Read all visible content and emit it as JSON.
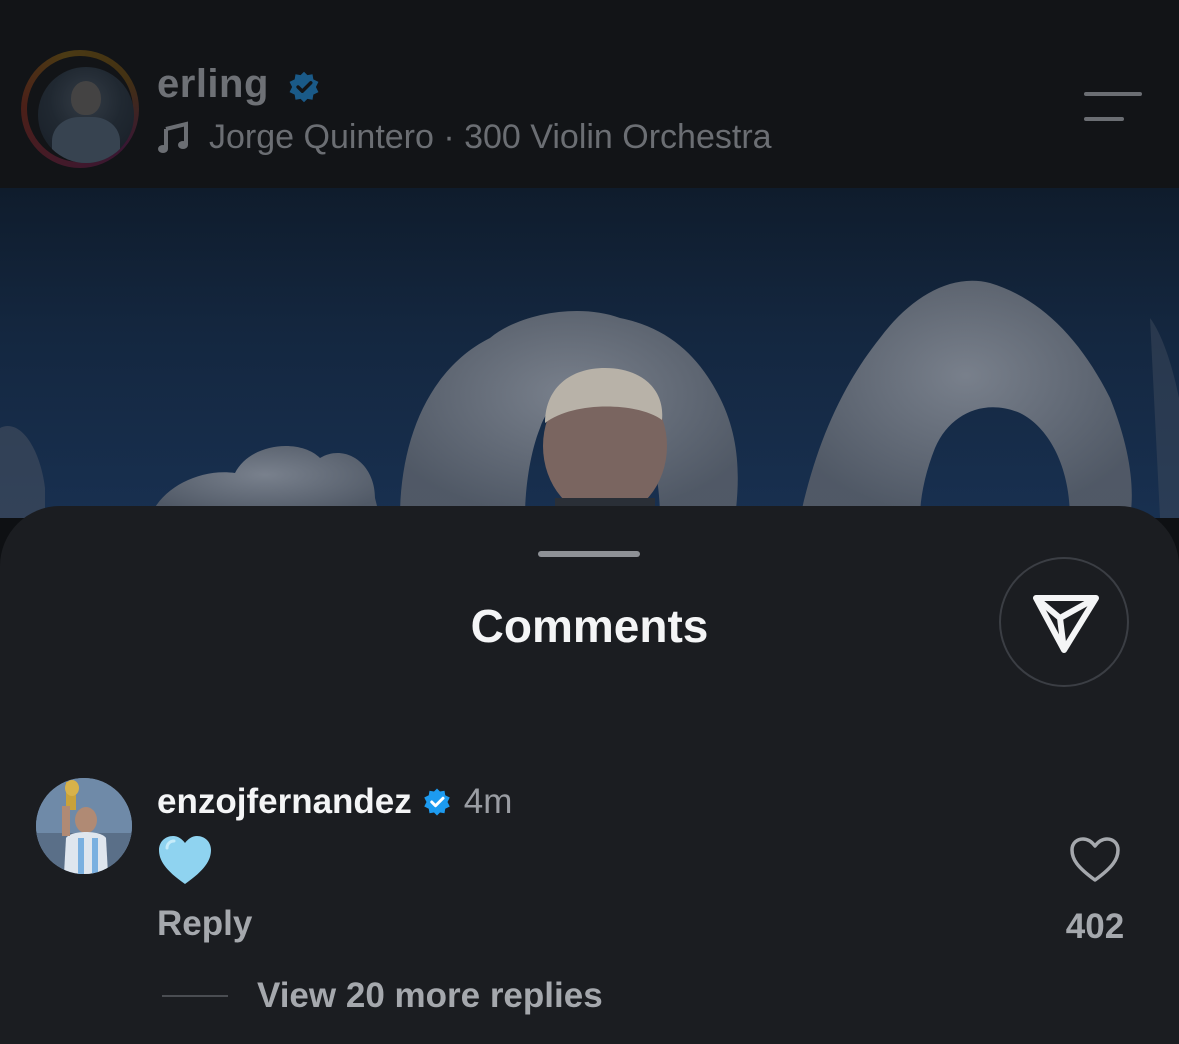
{
  "header": {
    "username": "erling",
    "music": "Jorge Quintero · 300 Violin Orchestra"
  },
  "sheet": {
    "title": "Comments"
  },
  "comment": {
    "author": "enzojfernandez",
    "time": "4m",
    "emoji": "blue-heart",
    "reply_label": "Reply",
    "like_count": "402",
    "view_replies": "View 20 more replies"
  },
  "colors": {
    "verified": "#1d9bf0",
    "sheet_bg": "#1b1d21",
    "header_bg": "#121417"
  }
}
